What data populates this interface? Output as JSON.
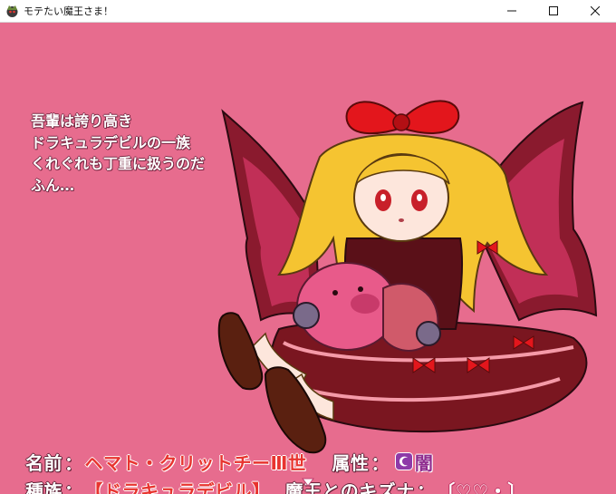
{
  "window": {
    "title": "モテたい魔王さま！",
    "icon": "game-app-icon",
    "controls": [
      "minimize-icon",
      "maximize-icon",
      "close-icon"
    ]
  },
  "dialogue": {
    "lines": [
      "吾輩は誇り高き",
      "ドラキュラデビルの一族",
      "くれぐれも丁重に扱うのだ",
      "ふん…"
    ]
  },
  "status": {
    "name_label": "名前",
    "name_value": "ヘマト・クリットチーⅢ世",
    "attribute_label": "属性",
    "attribute_value": "闇",
    "attribute_icon": "dark-attribute-icon",
    "race_label": "種族",
    "race_value": "【ドラキュラデビル】",
    "bond_label": "魔王とのキズナ",
    "bond_value": "〔♡♡・〕",
    "separator": "："
  },
  "colors": {
    "background": "#e76c8e",
    "value_red": "#e8342f",
    "dark_attribute": "#8e2b8e"
  },
  "indicator": {
    "icon": "next-page-arrow-icon"
  }
}
